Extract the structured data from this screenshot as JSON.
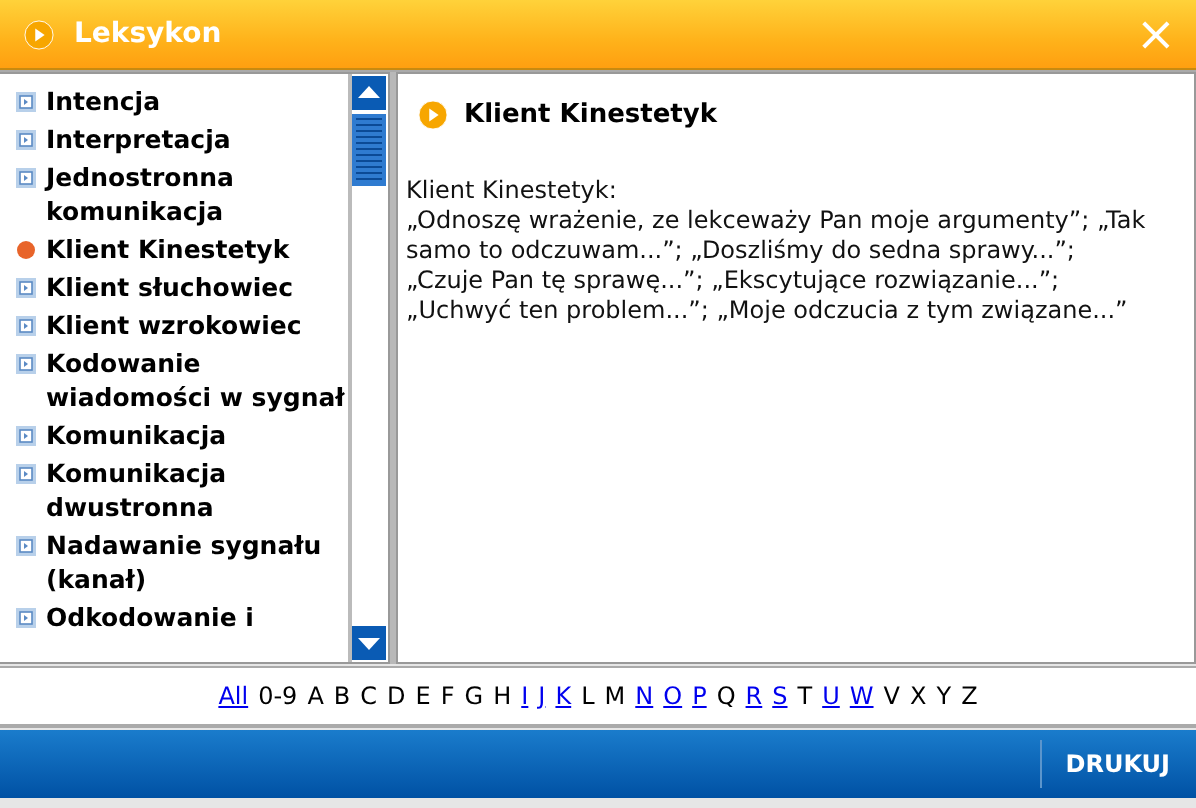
{
  "window": {
    "title": "Leksykon",
    "close": "×"
  },
  "terms": [
    {
      "label": "Intencja",
      "selected": false
    },
    {
      "label": "Interpretacja",
      "selected": false
    },
    {
      "label": "Jednostronna komunikacja",
      "selected": false
    },
    {
      "label": "Klient Kinestetyk",
      "selected": true
    },
    {
      "label": "Klient słuchowiec",
      "selected": false
    },
    {
      "label": "Klient wzrokowiec",
      "selected": false
    },
    {
      "label": "Kodowanie wiadomości w sygnał",
      "selected": false
    },
    {
      "label": "Komunikacja",
      "selected": false
    },
    {
      "label": "Komunikacja dwustronna",
      "selected": false
    },
    {
      "label": "Nadawanie sygnału (kanał)",
      "selected": false
    },
    {
      "label": "Odkodowanie i",
      "selected": false
    }
  ],
  "entry": {
    "heading": "Klient Kinestetyk",
    "lines": [
      "Klient Kinestetyk:",
      "„Odnoszę wrażenie, ze lekceważy Pan moje argumenty”; „Tak samo to odczuwam...”; „Doszliśmy do sedna sprawy...”; „Czuje Pan tę sprawę...”; „Ekscytujące rozwiązanie...”; „Uchwyć ten problem...”; „Moje odczucia z tym związane...”"
    ]
  },
  "alphabet": [
    {
      "label": "All",
      "link": true
    },
    {
      "label": "0-9",
      "link": false
    },
    {
      "label": "A",
      "link": false
    },
    {
      "label": "B",
      "link": false
    },
    {
      "label": "C",
      "link": false
    },
    {
      "label": "D",
      "link": false
    },
    {
      "label": "E",
      "link": false
    },
    {
      "label": "F",
      "link": false
    },
    {
      "label": "G",
      "link": false
    },
    {
      "label": "H",
      "link": false
    },
    {
      "label": "I",
      "link": true
    },
    {
      "label": "J",
      "link": true
    },
    {
      "label": "K",
      "link": true
    },
    {
      "label": "L",
      "link": false
    },
    {
      "label": "M",
      "link": false
    },
    {
      "label": "N",
      "link": true
    },
    {
      "label": "O",
      "link": true
    },
    {
      "label": "P",
      "link": true
    },
    {
      "label": "Q",
      "link": false
    },
    {
      "label": "R",
      "link": true
    },
    {
      "label": "S",
      "link": true
    },
    {
      "label": "T",
      "link": false
    },
    {
      "label": "U",
      "link": true
    },
    {
      "label": "W",
      "link": true
    },
    {
      "label": "V",
      "link": false
    },
    {
      "label": "X",
      "link": false
    },
    {
      "label": "Y",
      "link": false
    },
    {
      "label": "Z",
      "link": false
    }
  ],
  "footer": {
    "print_button": "DRUKUJ"
  }
}
